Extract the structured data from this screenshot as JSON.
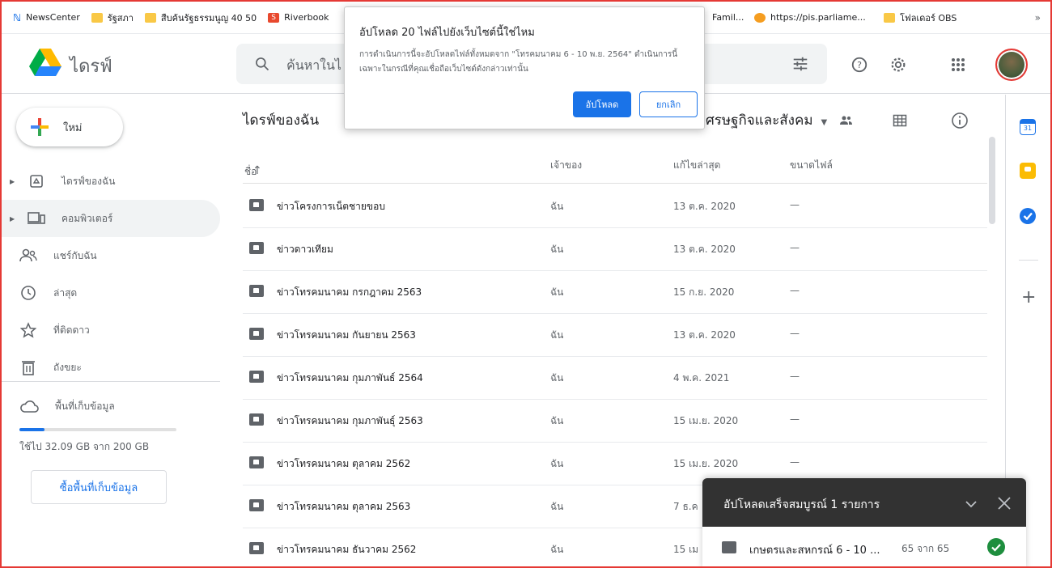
{
  "bookmarks": {
    "items": [
      {
        "label": "NewsCenter",
        "icon": "news-icon"
      },
      {
        "label": "รัฐสภา",
        "icon": "folder-icon"
      },
      {
        "label": "สืบค้นรัฐธรรมนูญ 40 50",
        "icon": "folder-icon"
      },
      {
        "label": "Riverbook",
        "icon": "shop-icon"
      }
    ],
    "right_items": [
      {
        "label": "Famil...",
        "icon": "folder-icon"
      },
      {
        "label": "https://pis.parliame...",
        "icon": "face-icon"
      },
      {
        "label": "โฟลเดอร์ OBS",
        "icon": "folder-icon"
      }
    ],
    "more": "»"
  },
  "header": {
    "app_name": "ไดรฟ์",
    "search_placeholder": "ค้นหาในไ"
  },
  "sidebar": {
    "new_label": "ใหม่",
    "items": [
      {
        "label": "ไดรฟ์ของฉัน",
        "icon": "my-drive-icon"
      },
      {
        "label": "คอมพิวเตอร์",
        "icon": "computer-icon"
      },
      {
        "label": "แชร์กับฉัน",
        "icon": "shared-icon"
      },
      {
        "label": "ล่าสุด",
        "icon": "clock-icon"
      },
      {
        "label": "ที่ติดดาว",
        "icon": "star-icon"
      },
      {
        "label": "ถังขยะ",
        "icon": "trash-icon"
      }
    ],
    "storage_label": "พื้นที่เก็บข้อมูล",
    "storage_usage": "ใช้ไป 32.09 GB จาก 200 GB",
    "storage_fraction": 0.16,
    "buy_label": "ซื้อพื้นที่เก็บข้อมูล"
  },
  "main": {
    "breadcrumb": "ไดรฟ์ของฉัน",
    "breadcrumb_sep": ">",
    "folder_title": "ศรษฐกิจและสังคม",
    "columns": {
      "name": "ชื่อ",
      "sort_arrow": "↑",
      "owner": "เจ้าของ",
      "modified": "แก้ไขล่าสุด",
      "size": "ขนาดไฟล์"
    },
    "rows": [
      {
        "name": "ข่าวโครงการเน็ตชายขอบ",
        "owner": "ฉัน",
        "modified": "13 ต.ค. 2020",
        "size": "—"
      },
      {
        "name": "ข่าวดาวเทียม",
        "owner": "ฉัน",
        "modified": "13 ต.ค. 2020",
        "size": "—"
      },
      {
        "name": "ข่าวโทรคมนาคม กรกฎาคม 2563",
        "owner": "ฉัน",
        "modified": "15 ก.ย. 2020",
        "size": "—"
      },
      {
        "name": "ข่าวโทรคมนาคม กันยายน 2563",
        "owner": "ฉัน",
        "modified": "13 ต.ค. 2020",
        "size": "—"
      },
      {
        "name": "ข่าวโทรคมนาคม กุมภาพันธ์ 2564",
        "owner": "ฉัน",
        "modified": "4 พ.ค. 2021",
        "size": "—"
      },
      {
        "name": "ข่าวโทรคมนาคม กุมภาพันธุ์ 2563",
        "owner": "ฉัน",
        "modified": "15 เม.ย. 2020",
        "size": "—"
      },
      {
        "name": "ข่าวโทรคมนาคม ตุลาคม 2562",
        "owner": "ฉัน",
        "modified": "15 เม.ย. 2020",
        "size": "—"
      },
      {
        "name": "ข่าวโทรคมนาคม ตุลาคม 2563",
        "owner": "ฉัน",
        "modified": "7 ธ.ค",
        "size": ""
      },
      {
        "name": "ข่าวโทรคมนาคม ธันวาคม 2562",
        "owner": "ฉัน",
        "modified": "15 เม",
        "size": ""
      }
    ]
  },
  "dialog": {
    "title": "อัปโหลด 20 ไฟล์ไปยังเว็บไซต์นี้ใช่ไหม",
    "body": "การดำเนินการนี้จะอัปโหลดไฟล์ทั้งหมดจาก \"โทรคมนาคม 6 - 10 พ.ย. 2564\" ดำเนินการนี้เฉพาะในกรณีที่คุณเชื่อถือเว็บไซต์ดังกล่าวเท่านั้น",
    "upload_label": "อัปโหลด",
    "cancel_label": "ยกเลิก"
  },
  "upload_panel": {
    "title": "อัปโหลดเสร็จสมบูรณ์ 1 รายการ",
    "file_name": "เกษตรและสหกรณ์ 6 - 10 ...",
    "count": "65 จาก 65"
  },
  "colors": {
    "accent": "#1a73e8",
    "border": "#e53935",
    "success": "#1e8e3e"
  }
}
